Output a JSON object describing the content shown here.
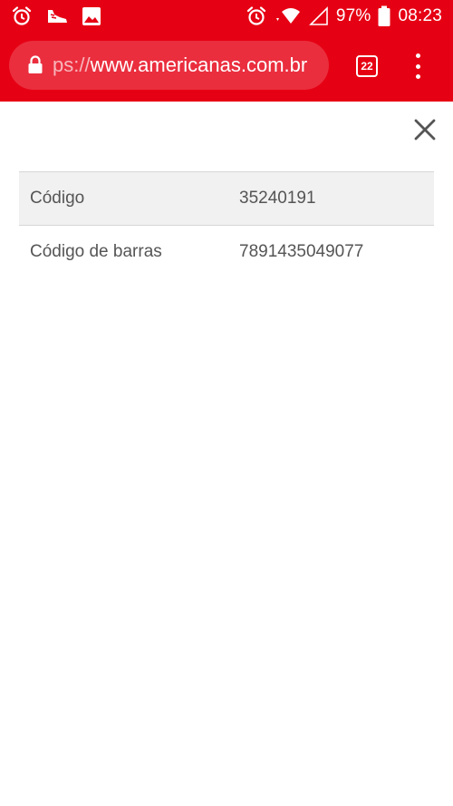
{
  "status_bar": {
    "left_icons": [
      "alarm-icon",
      "shoe-icon",
      "image-icon"
    ],
    "right_icons": [
      "alarm-icon",
      "wifi-icon",
      "signal-icon",
      "battery-icon"
    ],
    "battery_percent": "97%",
    "time": "08:23"
  },
  "browser": {
    "url_scheme_fragment": "ps://",
    "url_host": "www.americanas.com.br",
    "tab_count": "22",
    "theme_color": "#e60014"
  },
  "specs": {
    "rows": [
      {
        "label": "Código",
        "value": "35240191"
      },
      {
        "label": "Código de barras",
        "value": "7891435049077"
      }
    ]
  }
}
